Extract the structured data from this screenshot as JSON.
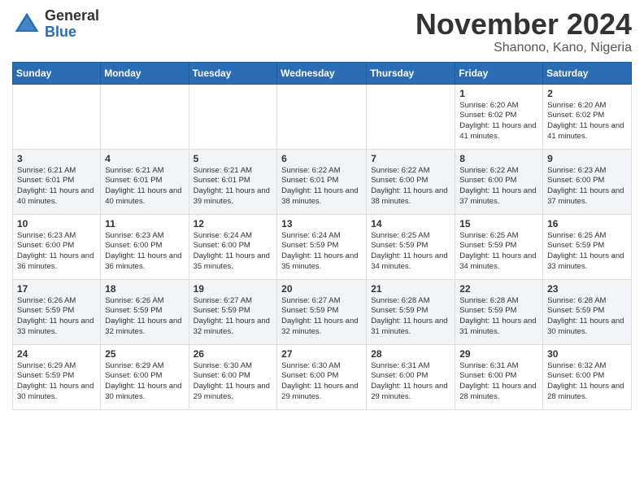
{
  "logo": {
    "general": "General",
    "blue": "Blue"
  },
  "title": "November 2024",
  "location": "Shanono, Kano, Nigeria",
  "weekdays": [
    "Sunday",
    "Monday",
    "Tuesday",
    "Wednesday",
    "Thursday",
    "Friday",
    "Saturday"
  ],
  "weeks": [
    [
      {
        "day": "",
        "info": ""
      },
      {
        "day": "",
        "info": ""
      },
      {
        "day": "",
        "info": ""
      },
      {
        "day": "",
        "info": ""
      },
      {
        "day": "",
        "info": ""
      },
      {
        "day": "1",
        "info": "Sunrise: 6:20 AM\nSunset: 6:02 PM\nDaylight: 11 hours and 41 minutes."
      },
      {
        "day": "2",
        "info": "Sunrise: 6:20 AM\nSunset: 6:02 PM\nDaylight: 11 hours and 41 minutes."
      }
    ],
    [
      {
        "day": "3",
        "info": "Sunrise: 6:21 AM\nSunset: 6:01 PM\nDaylight: 11 hours and 40 minutes."
      },
      {
        "day": "4",
        "info": "Sunrise: 6:21 AM\nSunset: 6:01 PM\nDaylight: 11 hours and 40 minutes."
      },
      {
        "day": "5",
        "info": "Sunrise: 6:21 AM\nSunset: 6:01 PM\nDaylight: 11 hours and 39 minutes."
      },
      {
        "day": "6",
        "info": "Sunrise: 6:22 AM\nSunset: 6:01 PM\nDaylight: 11 hours and 38 minutes."
      },
      {
        "day": "7",
        "info": "Sunrise: 6:22 AM\nSunset: 6:00 PM\nDaylight: 11 hours and 38 minutes."
      },
      {
        "day": "8",
        "info": "Sunrise: 6:22 AM\nSunset: 6:00 PM\nDaylight: 11 hours and 37 minutes."
      },
      {
        "day": "9",
        "info": "Sunrise: 6:23 AM\nSunset: 6:00 PM\nDaylight: 11 hours and 37 minutes."
      }
    ],
    [
      {
        "day": "10",
        "info": "Sunrise: 6:23 AM\nSunset: 6:00 PM\nDaylight: 11 hours and 36 minutes."
      },
      {
        "day": "11",
        "info": "Sunrise: 6:23 AM\nSunset: 6:00 PM\nDaylight: 11 hours and 36 minutes."
      },
      {
        "day": "12",
        "info": "Sunrise: 6:24 AM\nSunset: 6:00 PM\nDaylight: 11 hours and 35 minutes."
      },
      {
        "day": "13",
        "info": "Sunrise: 6:24 AM\nSunset: 5:59 PM\nDaylight: 11 hours and 35 minutes."
      },
      {
        "day": "14",
        "info": "Sunrise: 6:25 AM\nSunset: 5:59 PM\nDaylight: 11 hours and 34 minutes."
      },
      {
        "day": "15",
        "info": "Sunrise: 6:25 AM\nSunset: 5:59 PM\nDaylight: 11 hours and 34 minutes."
      },
      {
        "day": "16",
        "info": "Sunrise: 6:25 AM\nSunset: 5:59 PM\nDaylight: 11 hours and 33 minutes."
      }
    ],
    [
      {
        "day": "17",
        "info": "Sunrise: 6:26 AM\nSunset: 5:59 PM\nDaylight: 11 hours and 33 minutes."
      },
      {
        "day": "18",
        "info": "Sunrise: 6:26 AM\nSunset: 5:59 PM\nDaylight: 11 hours and 32 minutes."
      },
      {
        "day": "19",
        "info": "Sunrise: 6:27 AM\nSunset: 5:59 PM\nDaylight: 11 hours and 32 minutes."
      },
      {
        "day": "20",
        "info": "Sunrise: 6:27 AM\nSunset: 5:59 PM\nDaylight: 11 hours and 32 minutes."
      },
      {
        "day": "21",
        "info": "Sunrise: 6:28 AM\nSunset: 5:59 PM\nDaylight: 11 hours and 31 minutes."
      },
      {
        "day": "22",
        "info": "Sunrise: 6:28 AM\nSunset: 5:59 PM\nDaylight: 11 hours and 31 minutes."
      },
      {
        "day": "23",
        "info": "Sunrise: 6:28 AM\nSunset: 5:59 PM\nDaylight: 11 hours and 30 minutes."
      }
    ],
    [
      {
        "day": "24",
        "info": "Sunrise: 6:29 AM\nSunset: 5:59 PM\nDaylight: 11 hours and 30 minutes."
      },
      {
        "day": "25",
        "info": "Sunrise: 6:29 AM\nSunset: 6:00 PM\nDaylight: 11 hours and 30 minutes."
      },
      {
        "day": "26",
        "info": "Sunrise: 6:30 AM\nSunset: 6:00 PM\nDaylight: 11 hours and 29 minutes."
      },
      {
        "day": "27",
        "info": "Sunrise: 6:30 AM\nSunset: 6:00 PM\nDaylight: 11 hours and 29 minutes."
      },
      {
        "day": "28",
        "info": "Sunrise: 6:31 AM\nSunset: 6:00 PM\nDaylight: 11 hours and 29 minutes."
      },
      {
        "day": "29",
        "info": "Sunrise: 6:31 AM\nSunset: 6:00 PM\nDaylight: 11 hours and 28 minutes."
      },
      {
        "day": "30",
        "info": "Sunrise: 6:32 AM\nSunset: 6:00 PM\nDaylight: 11 hours and 28 minutes."
      }
    ]
  ]
}
